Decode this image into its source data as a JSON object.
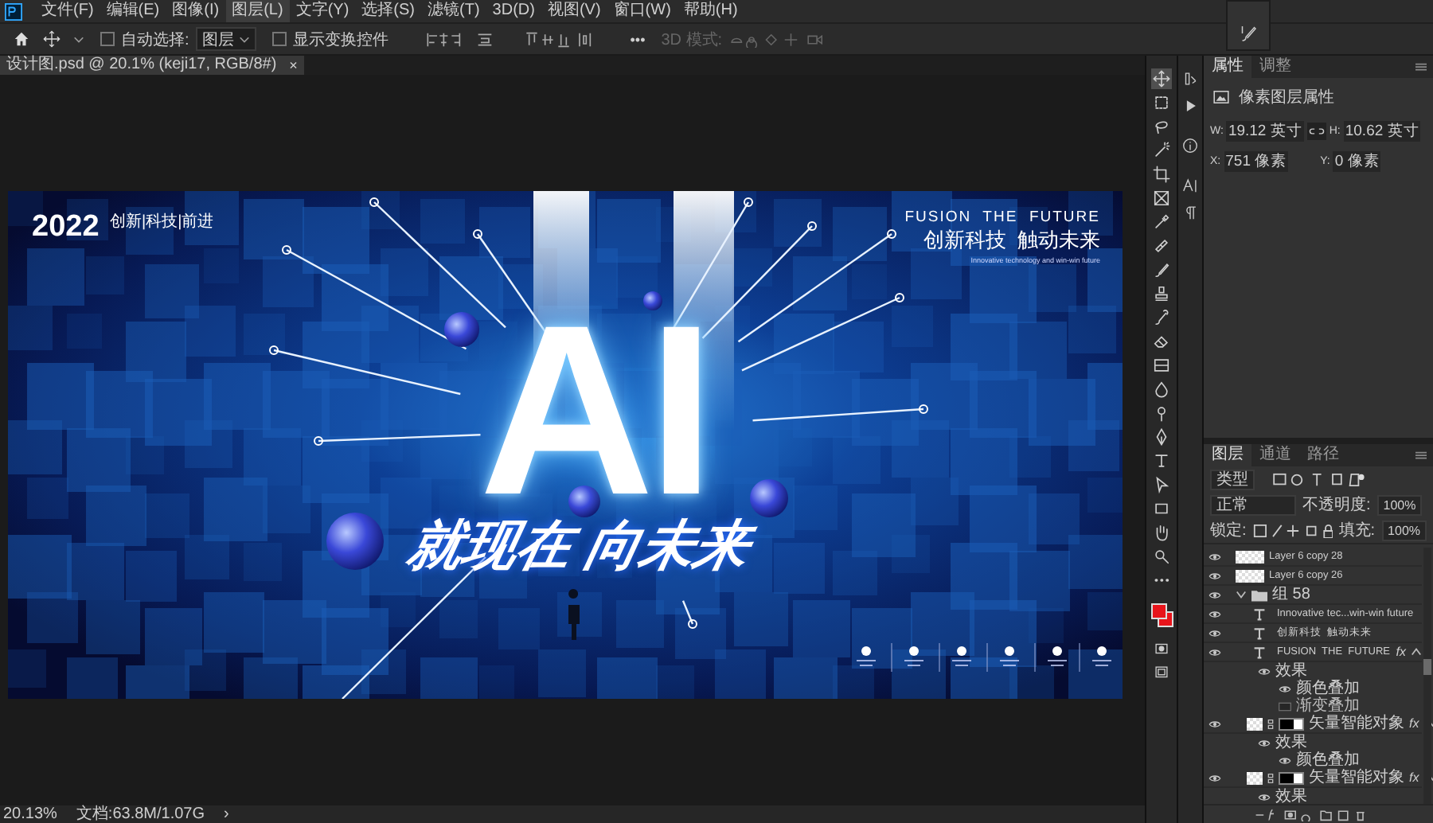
{
  "menu": [
    {
      "label": "文件(F)",
      "selected": false
    },
    {
      "label": "编辑(E)",
      "selected": false
    },
    {
      "label": "图像(I)",
      "selected": false
    },
    {
      "label": "图层(L)",
      "selected": true
    },
    {
      "label": "文字(Y)",
      "selected": false
    },
    {
      "label": "选择(S)",
      "selected": false
    },
    {
      "label": "滤镜(T)",
      "selected": false
    },
    {
      "label": "3D(D)",
      "selected": false
    },
    {
      "label": "视图(V)",
      "selected": false
    },
    {
      "label": "窗口(W)",
      "selected": false
    },
    {
      "label": "帮助(H)",
      "selected": false
    }
  ],
  "options_bar": {
    "auto_select": {
      "label": "自动选择:",
      "checked": false
    },
    "auto_select_target": "图层",
    "show_transform": {
      "label": "显示变换控件",
      "checked": false
    },
    "more": "•••",
    "mode_3d": {
      "label": "3D 模式:",
      "disabled": true
    }
  },
  "document_tab": {
    "title": "设计图.psd @ 20.1% (keji17, RGB/8#)",
    "close": "×"
  },
  "artwork": {
    "year": "2022",
    "tagline": "创新|科技|前进",
    "headline_en": "FUSION  THE  FUTURE",
    "headline_cn": "创新科技  触动未来",
    "subline": "Innovative technology and win-win future",
    "logo_text": "AI",
    "slogan": "就现在 向未来"
  },
  "status_bar": {
    "zoom": "20.13%",
    "document": "文档:63.8M/1.07G",
    "arrow": "›"
  },
  "tools": [
    {
      "kind": "move",
      "selected": true
    },
    {
      "kind": "marquee",
      "selected": false
    },
    {
      "kind": "lasso",
      "selected": false
    },
    {
      "kind": "wand",
      "selected": false
    },
    {
      "kind": "crop",
      "selected": false
    },
    {
      "kind": "frame",
      "selected": false
    },
    {
      "kind": "eyedropper",
      "selected": false
    },
    {
      "kind": "healing",
      "selected": false
    },
    {
      "kind": "brush",
      "selected": false
    },
    {
      "kind": "stamp",
      "selected": false
    },
    {
      "kind": "history",
      "selected": false
    },
    {
      "kind": "eraser",
      "selected": false
    },
    {
      "kind": "gradient",
      "selected": false
    },
    {
      "kind": "blur",
      "selected": false
    },
    {
      "kind": "dodge",
      "selected": false
    },
    {
      "kind": "pen",
      "selected": false
    },
    {
      "kind": "type",
      "selected": false
    },
    {
      "kind": "select",
      "selected": false
    },
    {
      "kind": "rectangle",
      "selected": false
    },
    {
      "kind": "hand",
      "selected": false
    },
    {
      "kind": "zoom",
      "selected": false
    },
    {
      "kind": "more",
      "selected": false
    }
  ],
  "properties": {
    "tabs": [
      {
        "label": "属性",
        "selected": true
      },
      {
        "label": "调整",
        "selected": false
      }
    ],
    "header": "像素图层属性",
    "w_label": "W:",
    "w_value": "19.12 英寸",
    "linked": true,
    "h_label": "H:",
    "h_value": "10.62 英寸",
    "x_label": "X:",
    "x_value": "751 像素",
    "y_label": "Y:",
    "y_value": "0 像素"
  },
  "layers_panel": {
    "tabs": [
      {
        "label": "图层",
        "selected": true
      },
      {
        "label": "通道",
        "selected": false
      },
      {
        "label": "路径",
        "selected": false
      }
    ],
    "filter": "类型",
    "blend_mode": "正常",
    "opacity_label": "不透明度:",
    "opacity": "100%",
    "lock_label": "锁定:",
    "fill_label": "填充:",
    "fill": "100%"
  },
  "layers": [
    {
      "kind": "pixel",
      "name": "Layer 6 copy 28",
      "visible": true
    },
    {
      "kind": "pixel",
      "name": "Layer 6 copy 26",
      "visible": true
    },
    {
      "kind": "group",
      "name": "组 58",
      "visible": true,
      "expanded": true,
      "children": [
        {
          "kind": "text",
          "name": "Innovative tec...win-win future",
          "visible": true
        },
        {
          "kind": "text",
          "name": "创新科技  触动未来",
          "visible": true
        },
        {
          "kind": "text",
          "name": "FUSION  THE  FUTURE",
          "visible": true,
          "fx": "fx",
          "expanded": true,
          "children": [
            {
              "kind": "effects",
              "name": "效果",
              "visible": true,
              "children": [
                {
                  "kind": "effect",
                  "name": "颜色叠加",
                  "visible": true
                },
                {
                  "kind": "effect",
                  "name": "渐变叠加",
                  "visible": false
                }
              ]
            }
          ]
        },
        {
          "kind": "smart",
          "name": "矢量智能对象",
          "visible": true,
          "fx": "fx",
          "expanded": true,
          "children": [
            {
              "kind": "effects",
              "name": "效果",
              "visible": true,
              "children": [
                {
                  "kind": "effect",
                  "name": "颜色叠加",
                  "visible": true
                }
              ]
            }
          ]
        },
        {
          "kind": "smart",
          "name": "矢量智能对象",
          "visible": true,
          "fx": "fx",
          "expanded": true,
          "children": [
            {
              "kind": "effects",
              "name": "效果",
              "visible": true
            }
          ]
        }
      ]
    }
  ]
}
